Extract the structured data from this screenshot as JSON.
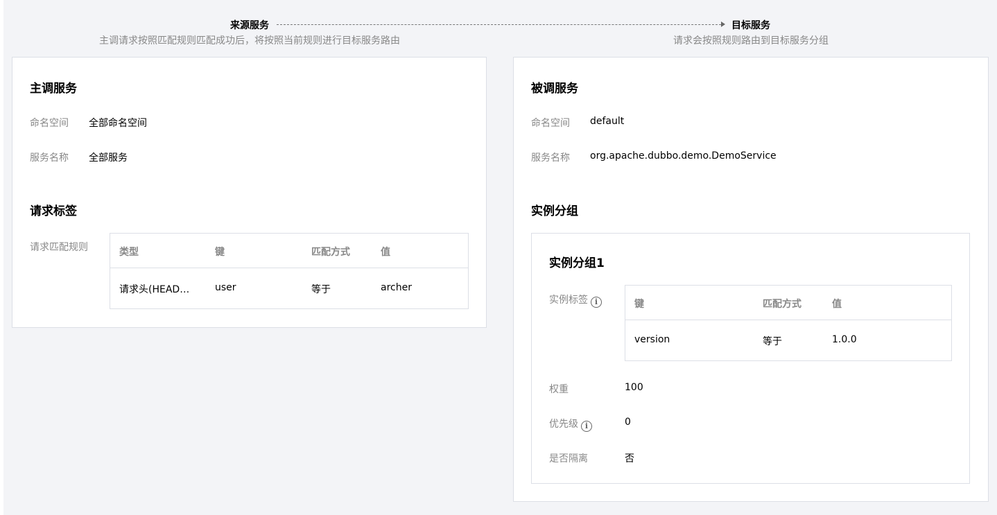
{
  "flow": {
    "source_title": "来源服务",
    "source_desc": "主调请求按照匹配规则匹配成功后，将按照当前规则进行目标服务路由",
    "target_title": "目标服务",
    "target_desc": "请求会按照规则路由到目标服务分组"
  },
  "caller": {
    "title": "主调服务",
    "namespace_label": "命名空间",
    "namespace_value": "全部命名空间",
    "service_label": "服务名称",
    "service_value": "全部服务",
    "tags_title": "请求标签",
    "match_rule_label": "请求匹配规则",
    "table": {
      "headers": [
        "类型",
        "键",
        "匹配方式",
        "值"
      ],
      "rows": [
        [
          "请求头(HEAD…",
          "user",
          "等于",
          "archer"
        ]
      ]
    }
  },
  "callee": {
    "title": "被调服务",
    "namespace_label": "命名空间",
    "namespace_value": "default",
    "service_label": "服务名称",
    "service_value": "org.apache.dubbo.demo.DemoService",
    "groups_title": "实例分组",
    "group": {
      "title": "实例分组1",
      "tag_label": "实例标签",
      "table": {
        "headers": [
          "键",
          "匹配方式",
          "值"
        ],
        "rows": [
          [
            "version",
            "等于",
            "1.0.0"
          ]
        ]
      },
      "weight_label": "权重",
      "weight_value": "100",
      "priority_label": "优先级",
      "priority_value": "0",
      "isolate_label": "是否隔离",
      "isolate_value": "否"
    }
  },
  "icons": {
    "info": "info-icon"
  }
}
